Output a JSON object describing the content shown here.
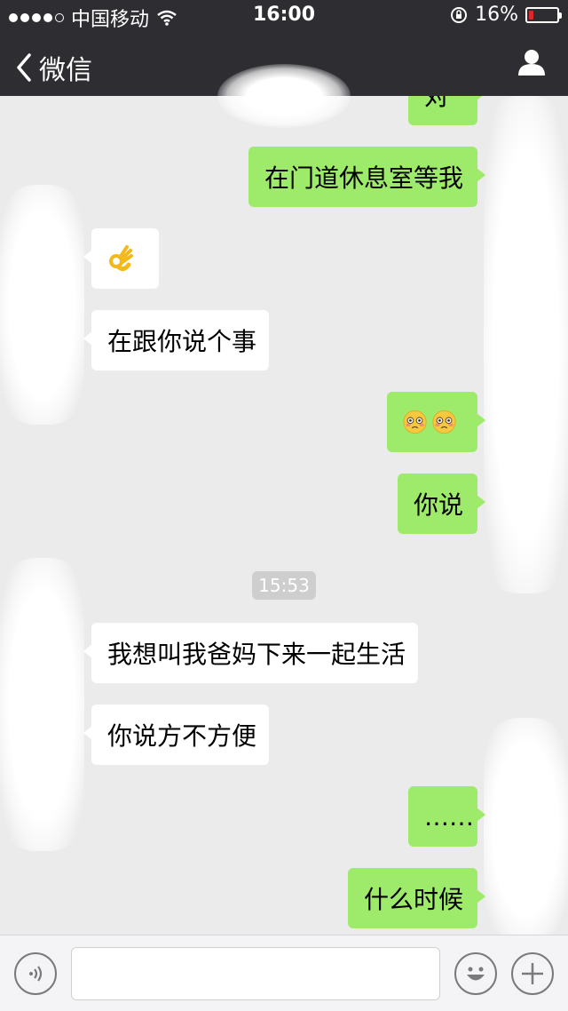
{
  "status_bar": {
    "carrier": "中国移动",
    "time": "16:00",
    "battery": "16%",
    "battery_level": 0.16,
    "battery_color": "#e0262b"
  },
  "nav": {
    "back_label": "微信"
  },
  "messages": [
    {
      "side": "out",
      "text": "对"
    },
    {
      "side": "out",
      "text": "在门道休息室等我"
    },
    {
      "side": "in",
      "emoji": "ok-hand-icon"
    },
    {
      "side": "in",
      "text": "在跟你说个事"
    },
    {
      "side": "out",
      "emoji": "pleading-face-icon x2"
    },
    {
      "side": "out",
      "text": "你说"
    },
    {
      "side": "in",
      "text": "我想叫我爸妈下来一起生活"
    },
    {
      "side": "in",
      "text": "你说方不方便"
    },
    {
      "side": "out",
      "text": "……"
    },
    {
      "side": "out",
      "text": "什么时候"
    }
  ],
  "timestamp": "15:53",
  "input": {
    "placeholder": ""
  },
  "colors": {
    "header_bg": "#2d2d32",
    "chat_bg": "#ebebeb",
    "outgoing_bubble": "#9eea6a",
    "incoming_bubble": "#ffffff"
  }
}
